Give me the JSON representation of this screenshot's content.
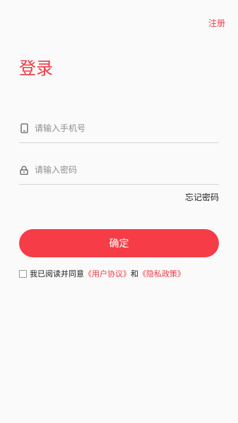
{
  "header": {
    "register_label": "注册"
  },
  "login": {
    "title": "登录",
    "phone_placeholder": "请输入手机号",
    "password_placeholder": "请输入密码",
    "forgot_label": "忘记密码",
    "confirm_label": "确定"
  },
  "agreement": {
    "checked": false,
    "prefix": "我已阅读并同意",
    "user_agreement": "《用户协议》",
    "conjunction": "和",
    "privacy_policy": "《隐私政策》"
  },
  "icons": {
    "phone": "phone-icon",
    "lock": "lock-icon"
  },
  "colors": {
    "accent": "#ee3a44",
    "button": "#f63c47",
    "background": "#fbfafa"
  }
}
